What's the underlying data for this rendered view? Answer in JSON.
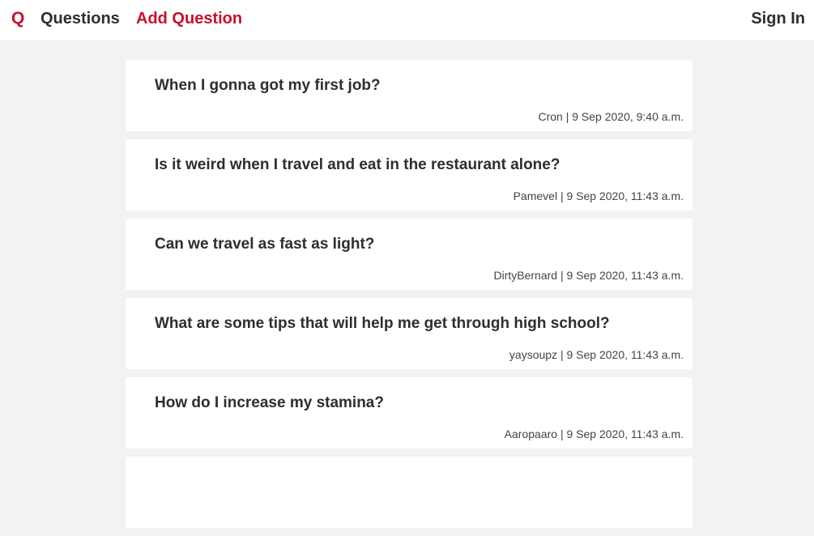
{
  "nav": {
    "logo": "Q",
    "questions_label": "Questions",
    "add_question_label": "Add Question",
    "sign_in_label": "Sign In"
  },
  "colors": {
    "brand": "#c8102e",
    "background": "#f2f2f2",
    "card": "#ffffff",
    "text": "#2e2e2e"
  },
  "questions": [
    {
      "title": "When I gonna got my first job?",
      "author": "Cron",
      "date": "9 Sep 2020, 9:40 a.m."
    },
    {
      "title": "Is it weird when I travel and eat in the restaurant alone?",
      "author": "Pamevel",
      "date": "9 Sep 2020, 11:43 a.m."
    },
    {
      "title": "Can we travel as fast as light?",
      "author": "DirtyBernard",
      "date": "9 Sep 2020, 11:43 a.m."
    },
    {
      "title": "What are some tips that will help me get through high school?",
      "author": "yaysoupz",
      "date": "9 Sep 2020, 11:43 a.m."
    },
    {
      "title": "How do I increase my stamina?",
      "author": "Aaropaaro",
      "date": "9 Sep 2020, 11:43 a.m."
    },
    {
      "title": "",
      "author": "",
      "date": ""
    }
  ]
}
